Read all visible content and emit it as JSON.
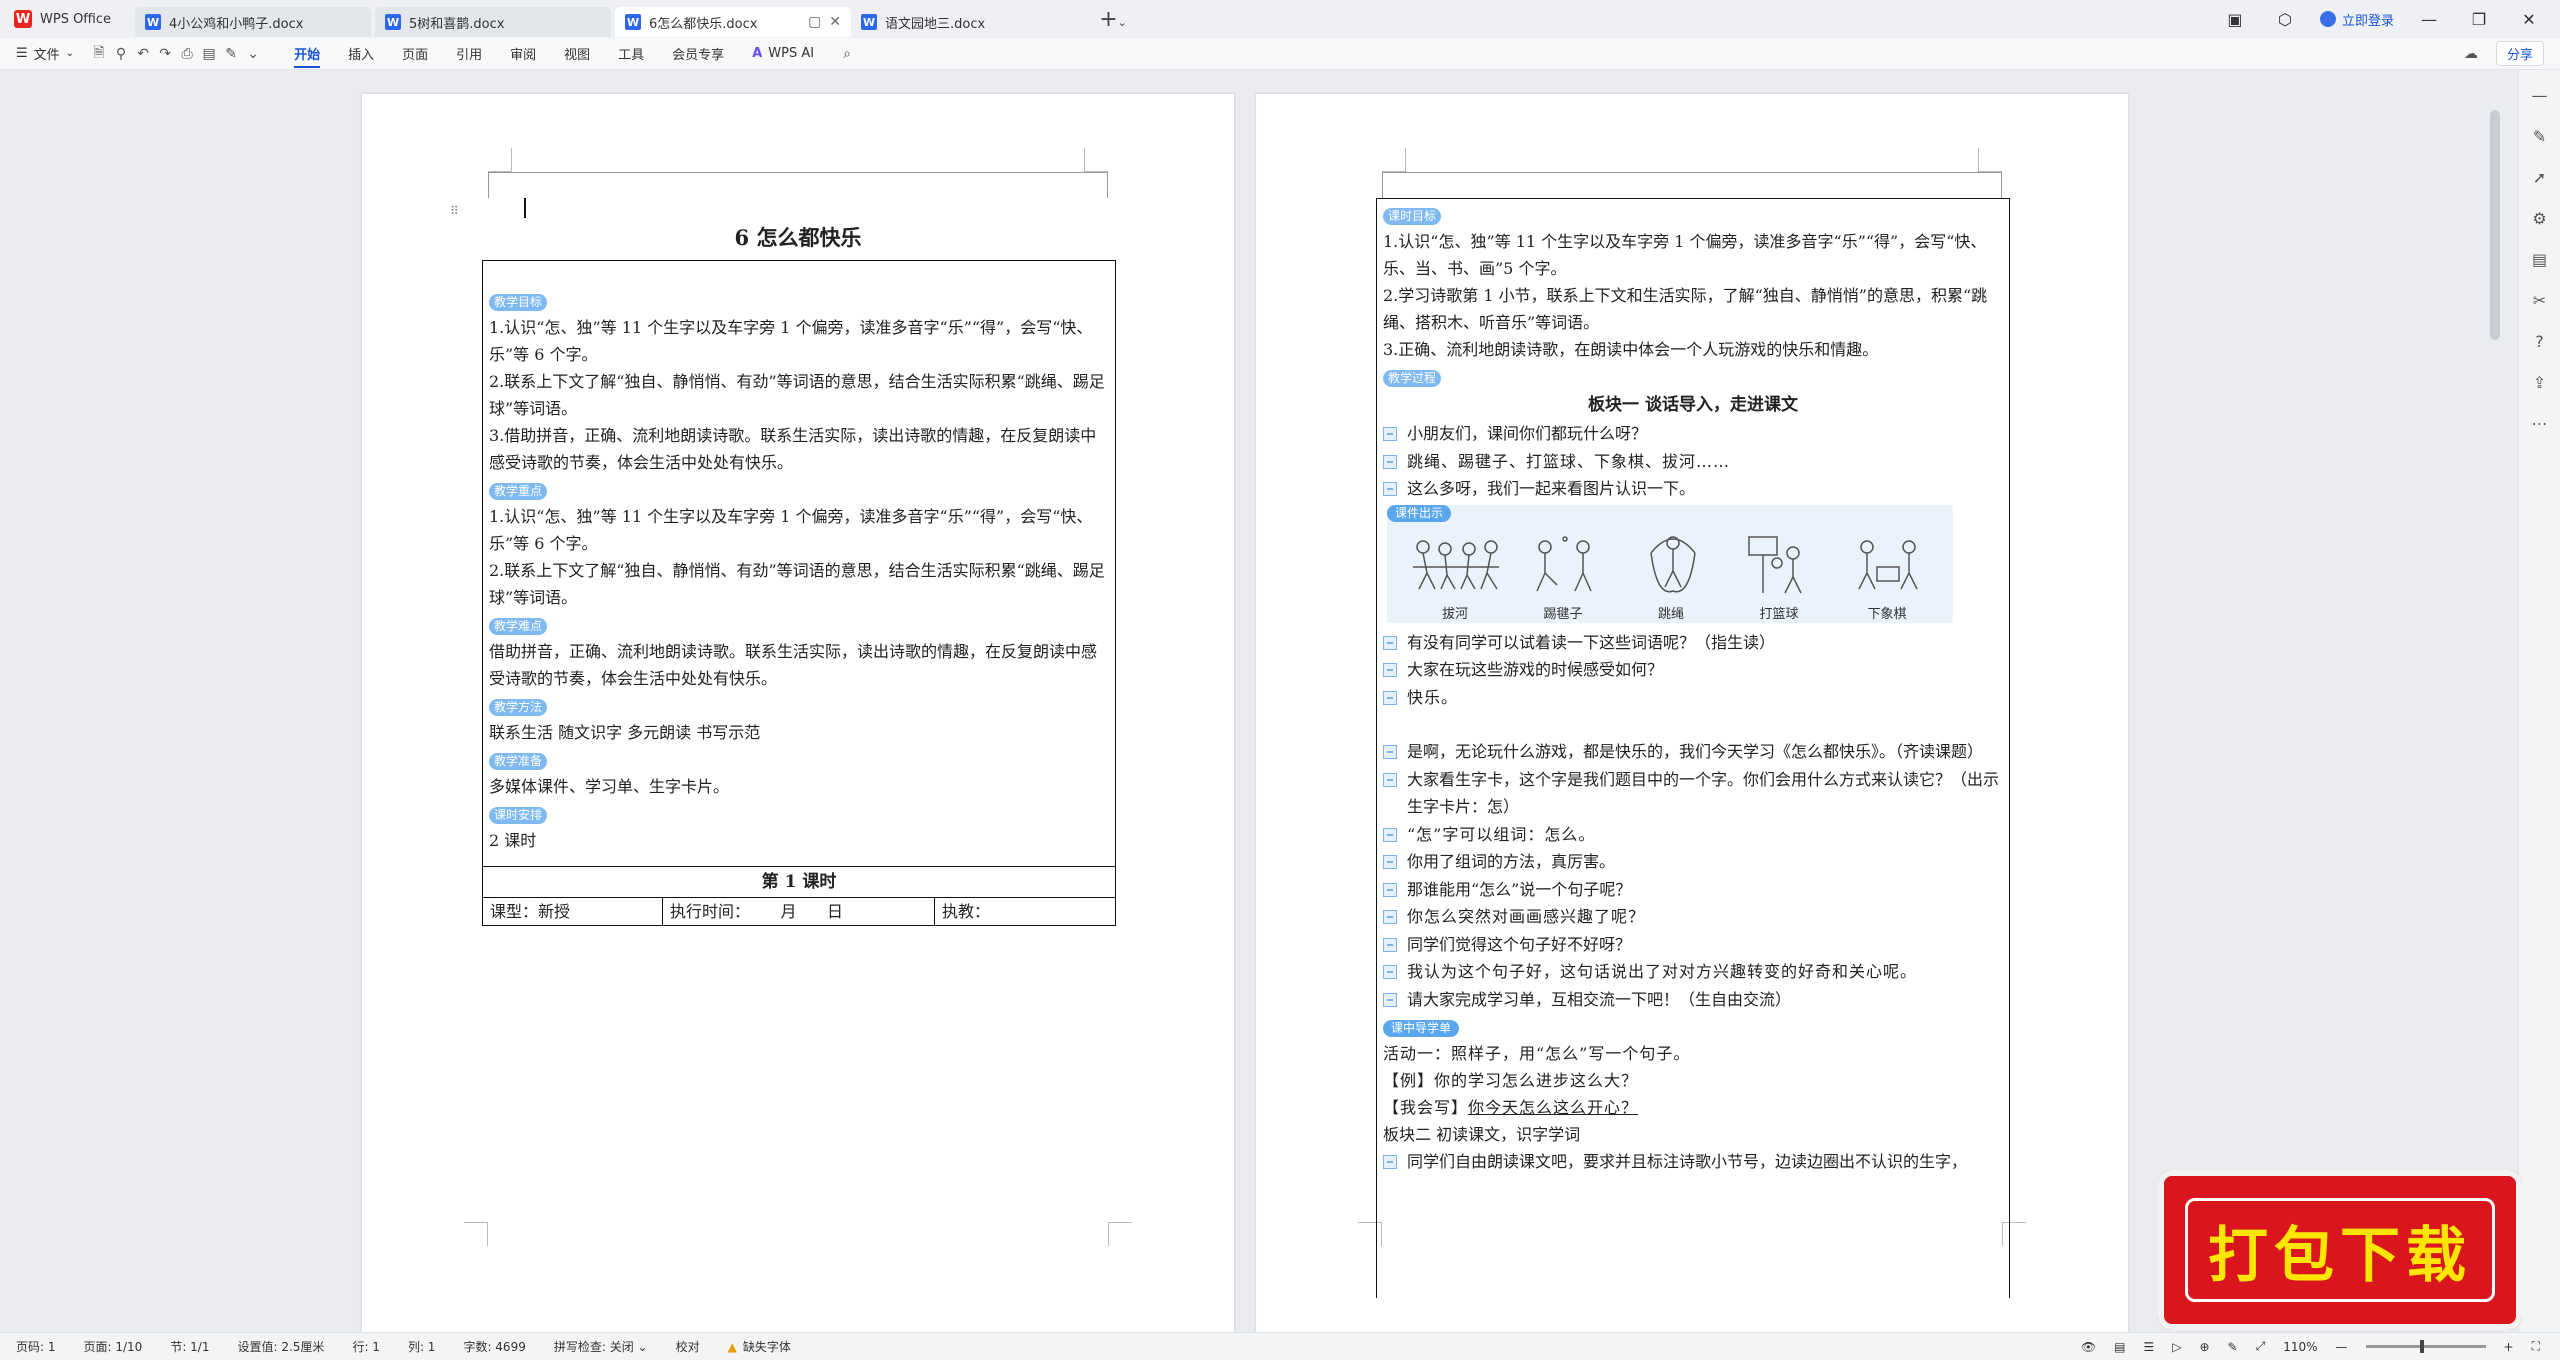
{
  "tabs": {
    "app_label": "WPS Office",
    "documents": [
      {
        "title": "4小公鸡和小鸭子.docx"
      },
      {
        "title": "5树和喜鹊.docx"
      },
      {
        "title": "6怎么都快乐.docx"
      },
      {
        "title": "语文园地三.docx"
      }
    ],
    "new_tab_icon": "+",
    "login_label": "立即登录"
  },
  "menu": {
    "file_label": "文件",
    "tabs": [
      "开始",
      "插入",
      "页面",
      "引用",
      "审阅",
      "视图",
      "工具",
      "会员专享"
    ],
    "ai_label": "WPS AI",
    "share_label": "分享"
  },
  "page1": {
    "title": "6 怎么都快乐",
    "sections": [
      {
        "tag": "教学目标",
        "lines": [
          "1.认识“怎、独”等 11 个生字以及车字旁 1 个偏旁，读准多音字“乐”“得”，会写“快、乐”等 6 个字。",
          "2.联系上下文了解“独自、静悄悄、有劲”等词语的意思，结合生活实际积累“跳绳、踢足球”等词语。",
          "3.借助拼音，正确、流利地朗读诗歌。联系生活实际，读出诗歌的情趣，在反复朗读中感受诗歌的节奏，体会生活中处处有快乐。"
        ]
      },
      {
        "tag": "教学重点",
        "lines": [
          "1.认识“怎、独”等 11 个生字以及车字旁 1 个偏旁，读准多音字“乐”“得”，会写“快、乐”等 6 个字。",
          "2.联系上下文了解“独自、静悄悄、有劲”等词语的意思，结合生活实际积累“跳绳、踢足球”等词语。"
        ]
      },
      {
        "tag": "教学难点",
        "lines": [
          "借助拼音，正确、流利地朗读诗歌。联系生活实际，读出诗歌的情趣，在反复朗读中感受诗歌的节奏，体会生活中处处有快乐。"
        ]
      },
      {
        "tag": "教学方法",
        "lines": [
          "联系生活 随文识字 多元朗读 书写示范"
        ]
      },
      {
        "tag": "教学准备",
        "lines": [
          "多媒体课件、学习单、生字卡片。"
        ]
      },
      {
        "tag": "课时安排",
        "lines": [
          "2 课时"
        ]
      }
    ],
    "lesson_title": "第 1 课时",
    "meta": {
      "type": "课型：新授",
      "time": "执行时间：      月      日",
      "teacher": "执教："
    }
  },
  "page2": {
    "goal_tag": "课时目标",
    "goals": [
      "1.认识“怎、独”等 11 个生字以及车字旁 1 个偏旁，读准多音字“乐”“得”，会写“快、乐、当、书、画”5 个字。",
      "2.学习诗歌第 1 小节，联系上下文和生活实际，了解“独自、静悄悄”的意思，积累“跳绳、搭积木、听音乐”等词语。",
      "3.正确、流利地朗读诗歌，在朗读中体会一个人玩游戏的快乐和情趣。"
    ],
    "process_tag": "教学过程",
    "block1_title": "板块一  谈话导入，走进课文",
    "qa1": [
      "小朋友们，课间你们都玩什么呀？",
      "跳绳、踢毽子、打篮球、下象棋、拔河……",
      "这么多呀，我们一起来看图片认识一下。"
    ],
    "courseware_tag": "课件出示",
    "pictures": [
      "拔河",
      "踢毽子",
      "跳绳",
      "打篮球",
      "下象棋"
    ],
    "qa2": [
      "有没有同学可以试着读一下这些词语呢？（指生读）",
      "大家在玩这些游戏的时候感受如何？",
      "快乐。"
    ],
    "qa3": [
      "是啊，无论玩什么游戏，都是快乐的，我们今天学习《怎么都快乐》。（齐读课题）",
      "大家看生字卡，这个字是我们题目中的一个字。你们会用什么方式来认读它？（出示生字卡片：怎）",
      "“怎”字可以组词：怎么。",
      "你用了组词的方法，真厉害。",
      "那谁能用“怎么”说一个句子呢？",
      "你怎么突然对画画感兴趣了呢？",
      "同学们觉得这个句子好不好呀？",
      "我认为这个句子好，这句话说出了对对方兴趣转变的好奇和关心呢。",
      "请大家完成学习单，互相交流一下吧！（生自由交流）"
    ],
    "worksheet_tag": "课中导学单",
    "activity1": "活动一：照样子，用“怎么”写一个句子。",
    "example": "【例】你的学习怎么进步这么大？",
    "i_write_label": "【我会写】",
    "i_write_answer": "你今天怎么这么开心？",
    "block2_title": "板块二  初读课文，识字学词",
    "last_line": "同学们自由朗读课文吧，要求并且标注诗歌小节号，边读边圈出不认识的生字，"
  },
  "status": {
    "page_code": "页码: 1",
    "page_count": "页面: 1/10",
    "section": "节: 1/1",
    "setting": "设置值: 2.5厘米",
    "row": "行: 1",
    "col": "列: 1",
    "words": "字数: 4699",
    "spell": "拼写检查: 关闭",
    "proofread": "校对",
    "missing_font": "缺失字体",
    "zoom": "110%"
  },
  "promo": {
    "label": "打包下载"
  }
}
